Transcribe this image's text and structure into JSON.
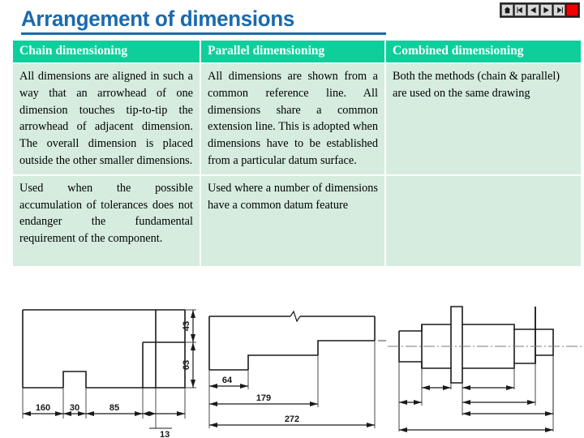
{
  "slide": {
    "title": "Arrangement of dimensions",
    "title_color": "#1b6aac",
    "header_bg": "#0ecf9c",
    "cell_bg": "#d5ecdf"
  },
  "navigation": {
    "buttons": [
      {
        "name": "home-icon",
        "label": "Home"
      },
      {
        "name": "previous-slide-icon",
        "label": "Previous slide"
      },
      {
        "name": "back-icon",
        "label": "Back"
      },
      {
        "name": "forward-icon",
        "label": "Forward"
      },
      {
        "name": "next-slide-icon",
        "label": "Next slide"
      },
      {
        "name": "stop-icon",
        "label": "Stop"
      }
    ],
    "stop_color": "#f20000"
  },
  "table": {
    "headers": [
      "Chain dimensioning",
      "Parallel dimensioning",
      "Combined dimensioning"
    ],
    "rows": [
      [
        "All dimensions are aligned in such a way that an arrowhead of one dimension touches tip-to-tip the arrowhead of adjacent dimension. The overall dimension is placed outside the other smaller dimensions.",
        "All dimensions are shown from a common reference line. All dimensions share a common extension line. This is adopted when dimensions have to be established from a particular datum surface.",
        "Both the methods (chain & parallel) are used on the same drawing"
      ],
      [
        "Used when the possible accumulation of tolerances does not endanger the fundamental requirement of the component.",
        "Used where a number of dimensions have a common datum feature",
        ""
      ]
    ]
  },
  "figures": {
    "chain": {
      "caption": "Chain dimensioning drawing",
      "horizontal_dims": [
        "160",
        "30",
        "85",
        "13"
      ],
      "vertical_dims": [
        "43",
        "63"
      ]
    },
    "parallel": {
      "caption": "Parallel dimensioning drawing",
      "dims": [
        "64",
        "179",
        "272"
      ]
    },
    "combined": {
      "caption": "Combined dimensioning drawing of a stepped shaft",
      "dims": []
    }
  }
}
